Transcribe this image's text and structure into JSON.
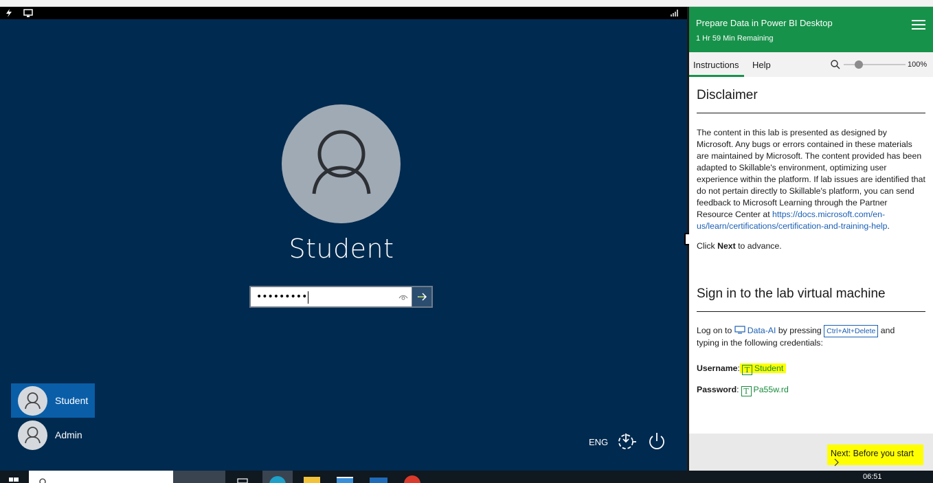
{
  "vm": {
    "user_name": "Student",
    "password_mask": "•••••••••",
    "users": [
      {
        "label": "Student",
        "selected": true
      },
      {
        "label": "Admin",
        "selected": false
      }
    ],
    "language": "ENG"
  },
  "panel": {
    "title": "Prepare Data in Power BI Desktop",
    "subtitle": "1 Hr 59 Min Remaining",
    "tabs": [
      {
        "label": "Instructions",
        "active": true
      },
      {
        "label": "Help",
        "active": false
      }
    ],
    "zoom": "100%",
    "zoom_level": 0.2,
    "disclaimer": {
      "heading": "Disclaimer",
      "body": "The content in this lab is presented as designed by Microsoft. Any bugs or errors contained in these materials are maintained by Microsoft. The content provided has been adapted to Skillable's environment, optimizing user experience within the platform. If lab issues are identified that do not pertain directly to Skillable's platform, you can send feedback to Microsoft Learning through the Partner Resource Center at ",
      "link": "https://docs.microsoft.com/en-us/learn/certifications/certification-and-training-help",
      "link_suffix": ".",
      "next_pre": "Click ",
      "next_bold": "Next",
      "next_post": " to advance."
    },
    "signin": {
      "heading": "Sign in to the lab virtual machine",
      "logon_pre": "Log on to",
      "vm_name": "Data-AI",
      "by_pressing": "by pressing",
      "keys": "Ctrl+Alt+Delete",
      "and": "and",
      "line2": "typing in the following credentials:",
      "username_label": "Username",
      "username_value": "Student",
      "password_label": "Password",
      "password_value": "Pa55w.rd",
      "colon": ":",
      "t_glyph": "T"
    },
    "next_button": "Next: Before you start"
  },
  "taskbar": {
    "time": "06:51"
  },
  "colors": {
    "vm_bg": "#002a4f",
    "panel_green": "#17924a",
    "highlight": "#ffff00",
    "link": "#1a5fb4"
  }
}
